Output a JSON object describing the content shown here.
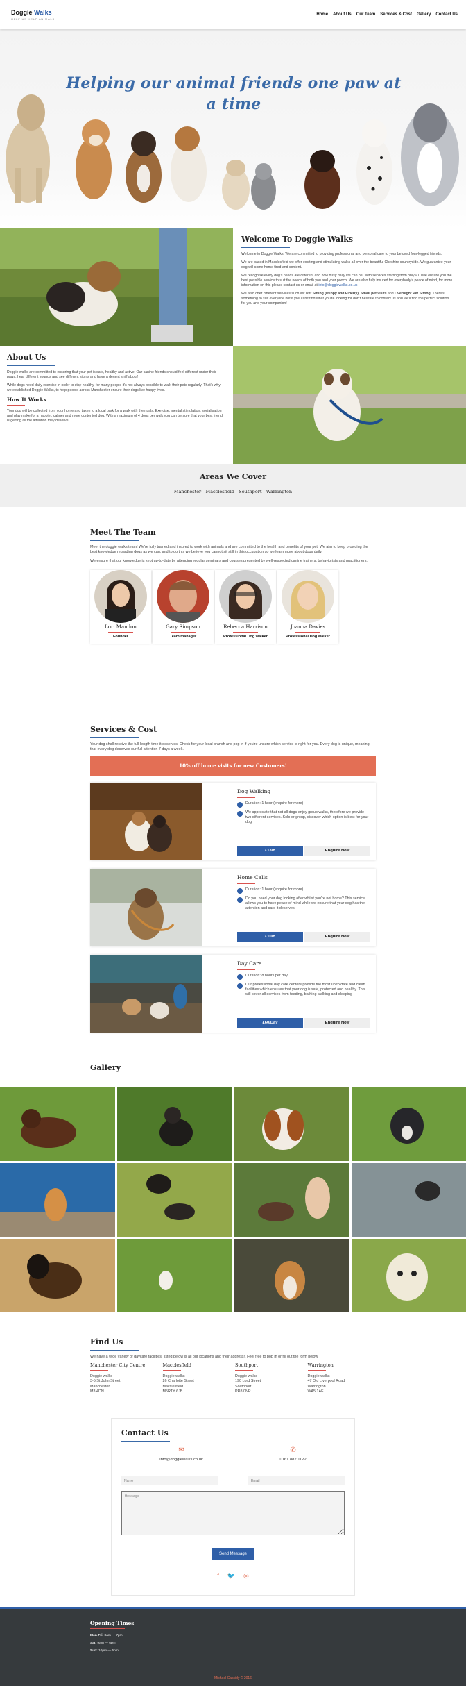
{
  "header": {
    "brand_a": "Doggie ",
    "brand_b": "Walks",
    "tagline": "HELP US HELP ANIMALS",
    "nav": [
      "Home",
      "About Us",
      "Our Team",
      "Services & Cost",
      "Gallery",
      "Contact Us"
    ]
  },
  "hero": {
    "title": "Helping our animal friends one paw at a time"
  },
  "welcome": {
    "title": "Welcome To Doggie Walks",
    "p1": "Welcome to Doggie Walks! We are committed to providing professional and personal care to your beloved four-legged friends.",
    "p2": "We are based in Macclesfield we offer exciting and stimulating walks all over the beautiful Cheshire countryside. We guarantee your dog will come home tired and content.",
    "p3a": "We recognise every dog's needs are different and how busy daily life can be. With services starting from only £10 we ensure you the best possible service to suit the needs of both you and your pooch. We are also fully insured for everybody's peace of mind, for more information on this please contact us or email at ",
    "email": "info@doggiewalks.co.uk",
    "p4a": "We also offer different services such as: ",
    "p4b": "Pet Sitting (Puppy and Elderly), Small pet visits",
    "p4c": " and ",
    "p4d": "Overnight Pet Sitting",
    "p4e": ". There's something to suit everyone but if you can't find what you're looking for don't hesitate to contact us and we'll find the perfect solution for you and your companion!"
  },
  "about": {
    "title": "About Us",
    "p1": "Doggie walks are committed to ensuring that your pet is safe, healthy and active. Our canine friends should feel different under their paws, hear different sounds and see different sights and have a decent sniff about!",
    "p2": "While dogs need daily exercise in order to stay healthy, for many people it's not always possible to walk their pets regularly. That's why we established Doggie Walks, to help people across Manchester ensure their dogs live happy lives.",
    "how_title": "How It Works",
    "p3": "Your dog will be collected from your home and taken to a local park for a walk with their pals. Exercise, mental stimulation, socialisation and play make for a happier, calmer and more contented dog. With a maximum of 4 dogs per walk you can be sure that your best friend is getting all the attention they deserve."
  },
  "areas": {
    "title": "Areas We Cover",
    "list": "Manchester - Macclesfield - Southport - Warrington"
  },
  "team": {
    "title": "Meet The Team",
    "p1": "Meet the doggie walks team! We're fully trained and insured to work with animals and are committed to the health and benefits of your pet. We aim to keep providing the best knowledge regarding dogs as we can, and to do this we believe you cannot sit still in this occupation so we learn more about dogs daily.",
    "p2": "We ensure that our knowledge is kept up-to-date by attending regular seminars and courses presented by well-respected canine trainers, behaviorists and practitioners.",
    "members": [
      {
        "name": "Lori Mandon",
        "role": "Founder"
      },
      {
        "name": "Gary Simpson",
        "role": "Team manager"
      },
      {
        "name": "Rebecca Harrison",
        "role": "Professional Dog walker"
      },
      {
        "name": "Joanna Davies",
        "role": "Professional Dog walker"
      }
    ]
  },
  "services": {
    "title": "Services & Cost",
    "intro": "Your dog shall receive the full-length time it deserves. Check for your local branch and pop in if you're unsure which service is right for you. Every dog is unique, meaning that every dog deserves our full attention 7 days a week.",
    "promo": "10% off home visits for new Customers!",
    "items": [
      {
        "name": "Dog Walking",
        "duration": "Duration: 1 hour (enquire for more)",
        "desc": "We appreciate that not all dogs enjoy group walks, therefore we provide two different services. Solo or group, discover which option is best for your dog.",
        "price": "£13/h",
        "enquire": "Enquire Now"
      },
      {
        "name": "Home Calls",
        "duration": "Duration: 1 hour (enquire for more)",
        "desc": "Do you need your dog looking after whilst you're not home? This service allows you to have peace of mind while we ensure that your dog has the attention and care it deserves.",
        "price": "£10/h",
        "enquire": "Enquire Now"
      },
      {
        "name": "Day Care",
        "duration": "Duration: 8 hours per day",
        "desc": "Our professional day care centers provide the most up to date and clean facilities which ensures that your dog is safe, protected and healthy. This will cover all services from feeding, bathing walking and sleeping",
        "price": "£60/Day",
        "enquire": "Enquire Now"
      }
    ]
  },
  "gallery": {
    "title": "Gallery"
  },
  "findus": {
    "title": "Find Us",
    "lead": "We have a wide variety of daycare facilities, listed below is all our locations and their address!. Feel free to pop in or fill out the form below.",
    "locations": [
      {
        "name": "Manchester City Centre",
        "l1": "Doggie walks",
        "l2": "3-5 St John Street",
        "l3": "Manchester",
        "l4": "M3 4DN"
      },
      {
        "name": "Macclesfield",
        "l1": "Doggie walks",
        "l2": "26 Charlotte Street",
        "l3": "Macclesfield",
        "l4": "M5RTY 6JB"
      },
      {
        "name": "Southport",
        "l1": "Doggie walks",
        "l2": "190 Lord Street",
        "l3": "Southport",
        "l4": "PR8 0NP"
      },
      {
        "name": "Warrington",
        "l1": "Doggie walks",
        "l2": "47 Old Liverpool Road",
        "l3": "Warrington",
        "l4": "WA5 1AF"
      }
    ]
  },
  "contact": {
    "title": "Contact Us",
    "email": "info@doggiewalks.co.uk",
    "phone": "0161 882 1122",
    "name_ph": "Name",
    "email_ph": "Email",
    "message_ph": "Message",
    "send": "Send Message"
  },
  "footer": {
    "title": "Opening Times",
    "mon_fri_day": "Mon-Fri:",
    "mon_fri_time": " 8am — 7pm",
    "sat_day": "Sat:",
    "sat_time": " 9am — 6pm",
    "sun_day": "Sun:",
    "sun_time": " 10pm — 5pm",
    "copyright": "Michael Cassidy © 2016"
  },
  "colors": {
    "accent_blue": "#2f5fa8",
    "accent_coral": "#e36f55",
    "footer_bg": "#363a3d"
  }
}
